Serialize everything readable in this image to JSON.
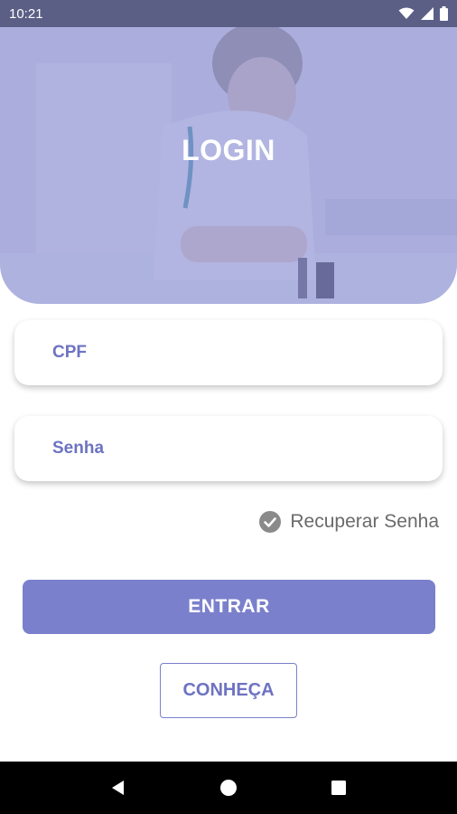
{
  "status_bar": {
    "time": "10:21"
  },
  "header": {
    "title": "LOGIN"
  },
  "form": {
    "cpf_placeholder": "CPF",
    "password_placeholder": "Senha"
  },
  "recover": {
    "label": "Recuperar Senha"
  },
  "buttons": {
    "enter_label": "ENTRAR",
    "learn_label": "CONHEÇA"
  },
  "colors": {
    "accent": "#7a80cc",
    "accent_text": "#6d73c2",
    "status_bar": "#5b5f86",
    "nav_bar": "#000000"
  },
  "icons": {
    "wifi": "wifi-icon",
    "signal": "signal-icon",
    "battery": "battery-icon",
    "check": "check-circle-icon",
    "back": "back-icon",
    "home": "home-icon",
    "recents": "recents-icon"
  }
}
